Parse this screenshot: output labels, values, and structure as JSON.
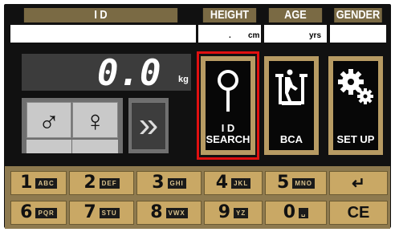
{
  "header": {
    "id_label": "I D",
    "height_label": "HEIGHT",
    "age_label": "AGE",
    "gender_label": "GENDER"
  },
  "inputs": {
    "id_value": "",
    "height_value": ".",
    "height_unit": "cm",
    "age_value": "",
    "age_unit": "yrs",
    "gender_value": ""
  },
  "weight": {
    "value": "0.0",
    "unit": "kg"
  },
  "gender_buttons": {
    "male": "♂",
    "female": "♀"
  },
  "next_label": "»",
  "functions": {
    "id_search_line1": "I D",
    "id_search_line2": "SEARCH",
    "bca": "BCA",
    "setup": "SET UP"
  },
  "keypad": {
    "row1": [
      {
        "num": "1",
        "letters": "ABC"
      },
      {
        "num": "2",
        "letters": "DEF"
      },
      {
        "num": "3",
        "letters": "GHI"
      },
      {
        "num": "4",
        "letters": "JKL"
      },
      {
        "num": "5",
        "letters": "MNO"
      }
    ],
    "row2": [
      {
        "num": "6",
        "letters": "PQR"
      },
      {
        "num": "7",
        "letters": "STU"
      },
      {
        "num": "8",
        "letters": "VWX"
      },
      {
        "num": "9",
        "letters": "YZ"
      },
      {
        "num": "0",
        "letters": "␣"
      }
    ],
    "enter_label": "↵",
    "clear_label": "CE"
  }
}
